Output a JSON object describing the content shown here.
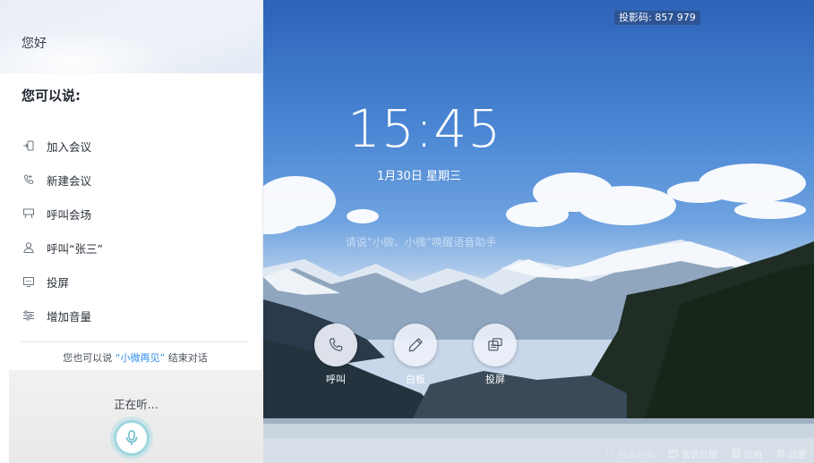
{
  "projection": {
    "label": "投影码: 857 979"
  },
  "clock": {
    "time": "15:45",
    "date": "1月30日 星期三"
  },
  "hint": "请说“小微、小微”唤醒语音助手",
  "actions": [
    {
      "label": "呼叫",
      "icon": "phone-icon"
    },
    {
      "label": "白板",
      "icon": "pen-icon"
    },
    {
      "label": "投屏",
      "icon": "screen-share-icon"
    }
  ],
  "bottom_bar": [
    {
      "label": "结束所有",
      "icon": "exit-icon"
    },
    {
      "label": "会议日程",
      "icon": "calendar-icon"
    },
    {
      "label": "应用",
      "icon": "grid-icon"
    },
    {
      "label": "设置",
      "icon": "gear-icon"
    }
  ],
  "assistant": {
    "greeting": "您好",
    "can_say": "您可以说:",
    "commands": [
      {
        "label": "加入会议",
        "icon": "join-meeting-icon"
      },
      {
        "label": "新建会议",
        "icon": "new-call-icon"
      },
      {
        "label": "呼叫会场",
        "icon": "venue-icon"
      },
      {
        "label": "呼叫“张三”",
        "icon": "person-icon"
      },
      {
        "label": "投屏",
        "icon": "screen-icon"
      },
      {
        "label": "增加音量",
        "icon": "volume-slider-icon"
      }
    ],
    "end_tip_prefix": "您也可以说 ",
    "end_tip_highlight": "“小微再见”",
    "end_tip_suffix": " 结束对话",
    "listening": "正在听..."
  },
  "colors": {
    "accent": "#2f8ce8",
    "mic_ring": "#9fd6df"
  }
}
